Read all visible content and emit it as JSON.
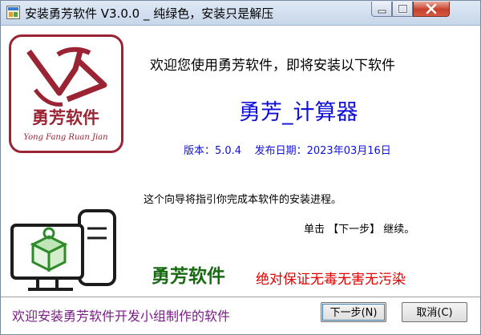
{
  "window": {
    "title": "安装勇芳软件 V3.0.0 _ 纯绿色，安装只是解压"
  },
  "logo": {
    "brand_text": "勇芳软件",
    "pinyin": "Yong Fang Ruan Jian"
  },
  "content": {
    "welcome": "欢迎您使用勇芳软件，即将安装以下软件",
    "product_name": "勇芳_计算器",
    "version_line": "版本：5.0.4    发布日期：2023年03月16日",
    "guide_line": "这个向导将指引你完成本软件的安装进程。",
    "next_hint": "单击 【下一步】 继续。",
    "brand_name": "勇芳软件",
    "guarantee": "绝对保证无毒无害无污染"
  },
  "footer": {
    "text": "欢迎安装勇芳软件开发小组制作的软件",
    "next_button": "下一步(N)",
    "cancel_button": "取消(C)"
  },
  "colors": {
    "logo_red": "#9a2433",
    "product_blue": "#1010d8",
    "brand_green": "#1a6a14",
    "guarantee_red": "#e00000",
    "footer_purple": "#7a1d86"
  },
  "icons": [
    "installer-app-icon",
    "minimize-icon",
    "maximize-icon",
    "close-icon",
    "computer-package-icon"
  ]
}
